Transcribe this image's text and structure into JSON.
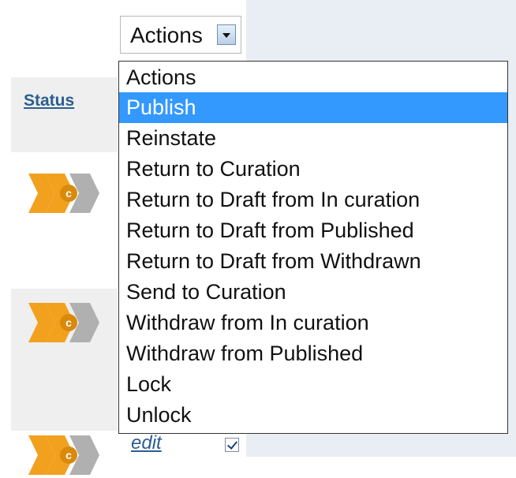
{
  "table": {
    "status_header": "Status",
    "rows": [
      {
        "status_code": "c"
      },
      {
        "status_code": "c"
      },
      {
        "status_code": "c",
        "edit_label": "edit",
        "checked": true
      }
    ]
  },
  "actions_select": {
    "selected_label": "Actions",
    "options": [
      "Actions",
      "Publish",
      "Reinstate",
      "Return to Curation",
      "Return to Draft from In curation",
      "Return to Draft from Published",
      "Return to Draft from Withdrawn",
      "Send to Curation",
      "Withdraw from In curation",
      "Withdraw from Published",
      "Lock",
      "Unlock"
    ],
    "highlighted_option": "Publish"
  },
  "colors": {
    "highlight": "#3399ff",
    "link": "#2c5e92",
    "status_orange": "#f2a11f",
    "status_gray": "#b0b0b0"
  },
  "icons": {
    "status": "status-chevron-icon",
    "dropdown_arrow": "chevron-down-icon"
  }
}
